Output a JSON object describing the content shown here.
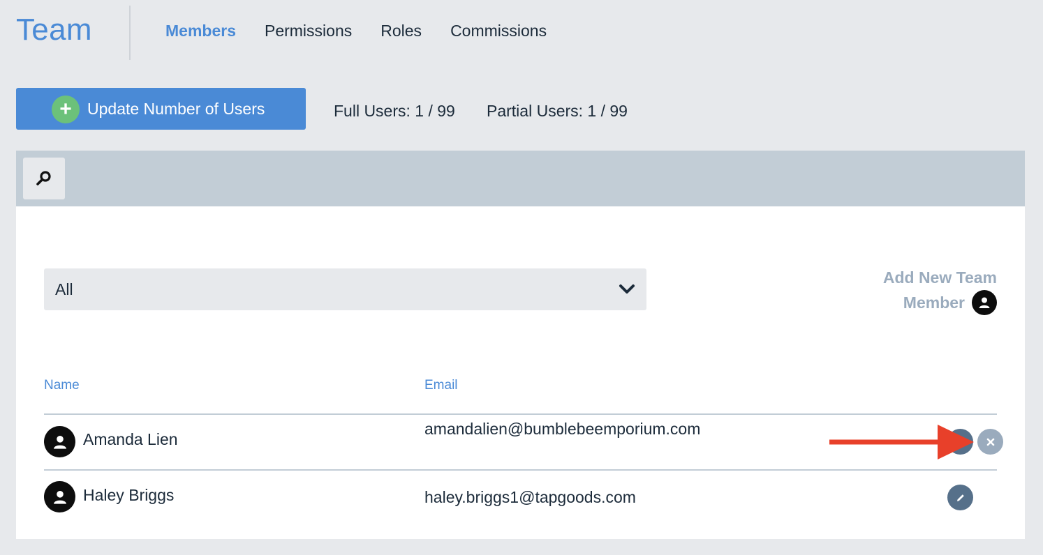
{
  "header": {
    "title": "Team",
    "tabs": [
      {
        "label": "Members",
        "active": true
      },
      {
        "label": "Permissions",
        "active": false
      },
      {
        "label": "Roles",
        "active": false
      },
      {
        "label": "Commissions",
        "active": false
      }
    ]
  },
  "toolbar": {
    "update_button_label": "Update Number of Users",
    "full_users": "Full Users: 1 / 99",
    "partial_users": "Partial Users: 1 / 99"
  },
  "search": {
    "icon": "search-icon"
  },
  "filter": {
    "selected": "All"
  },
  "add_member": {
    "line1": "Add New Team",
    "line2": "Member"
  },
  "table": {
    "columns": [
      "Name",
      "Email"
    ],
    "rows": [
      {
        "name": "Amanda Lien",
        "email": "amandalien@bumblebeemporium.com"
      },
      {
        "name": "Haley Briggs",
        "email": "haley.briggs1@tapgoods.com"
      }
    ]
  },
  "colors": {
    "accent": "#4a8ad6",
    "add_green": "#6cc17a",
    "annotation_arrow": "#e8402a"
  }
}
